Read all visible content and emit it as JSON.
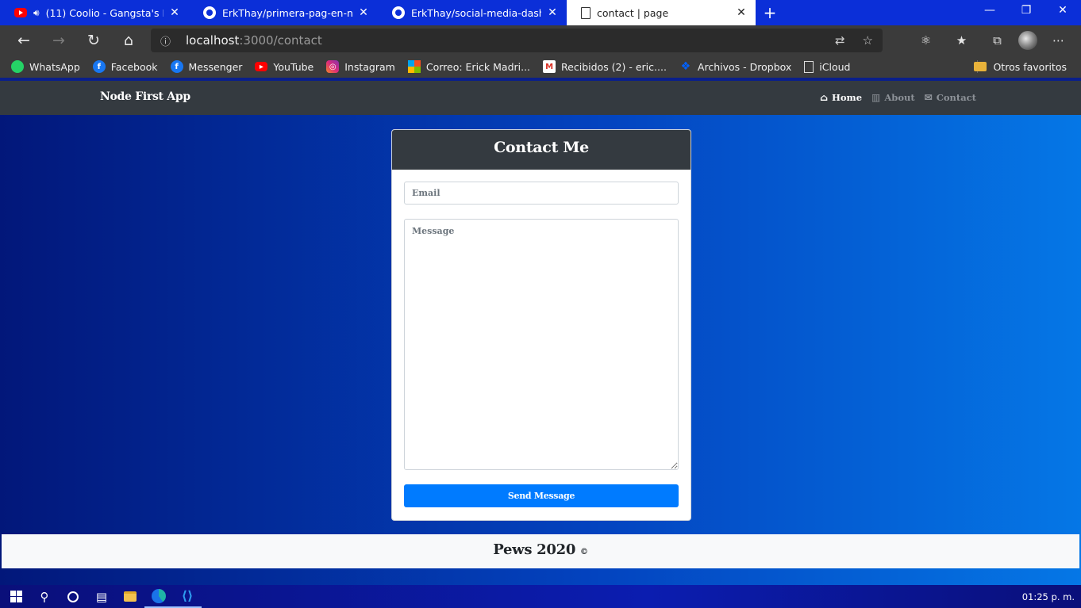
{
  "browser": {
    "tabs": [
      {
        "title": "(11) Coolio - Gangsta's Paradise",
        "icon": "youtube-icon",
        "audio": true,
        "active": false
      },
      {
        "title": "ErkThay/primera-pag-en-node",
        "icon": "github-icon",
        "active": false
      },
      {
        "title": "ErkThay/social-media-dashboard",
        "icon": "github-icon",
        "active": false
      },
      {
        "title": "contact | page",
        "icon": "document-icon",
        "active": true
      }
    ],
    "new_tab_label": "+",
    "window_controls": {
      "minimize": "—",
      "restore": "❐",
      "close": "✕"
    },
    "url_host": "localhost",
    "url_rest": ":3000/contact",
    "bookmarks": [
      {
        "label": "WhatsApp",
        "icon": "whatsapp-icon"
      },
      {
        "label": "Facebook",
        "icon": "facebook-icon"
      },
      {
        "label": "Messenger",
        "icon": "facebook-icon"
      },
      {
        "label": "YouTube",
        "icon": "youtube-icon"
      },
      {
        "label": "Instagram",
        "icon": "instagram-icon"
      },
      {
        "label": "Correo: Erick Madri...",
        "icon": "microsoft-icon"
      },
      {
        "label": "Recibidos (2) - eric....",
        "icon": "gmail-icon"
      },
      {
        "label": "Archivos - Dropbox",
        "icon": "dropbox-icon"
      },
      {
        "label": "iCloud",
        "icon": "document-icon"
      }
    ],
    "other_favorites": "Otros favoritos"
  },
  "app": {
    "brand": "Node First App",
    "nav": [
      {
        "label": "Home",
        "icon": "home-icon",
        "active": true
      },
      {
        "label": "About",
        "icon": "building-icon",
        "active": false
      },
      {
        "label": "Contact",
        "icon": "envelope-icon",
        "active": false
      }
    ],
    "card_title": "Contact Me",
    "email_placeholder": "Email",
    "message_placeholder": "Message",
    "submit_label": "Send Message",
    "footer_text": "Pews 2020",
    "footer_symbol": "©"
  },
  "taskbar": {
    "clock": "01:25 p. m."
  }
}
